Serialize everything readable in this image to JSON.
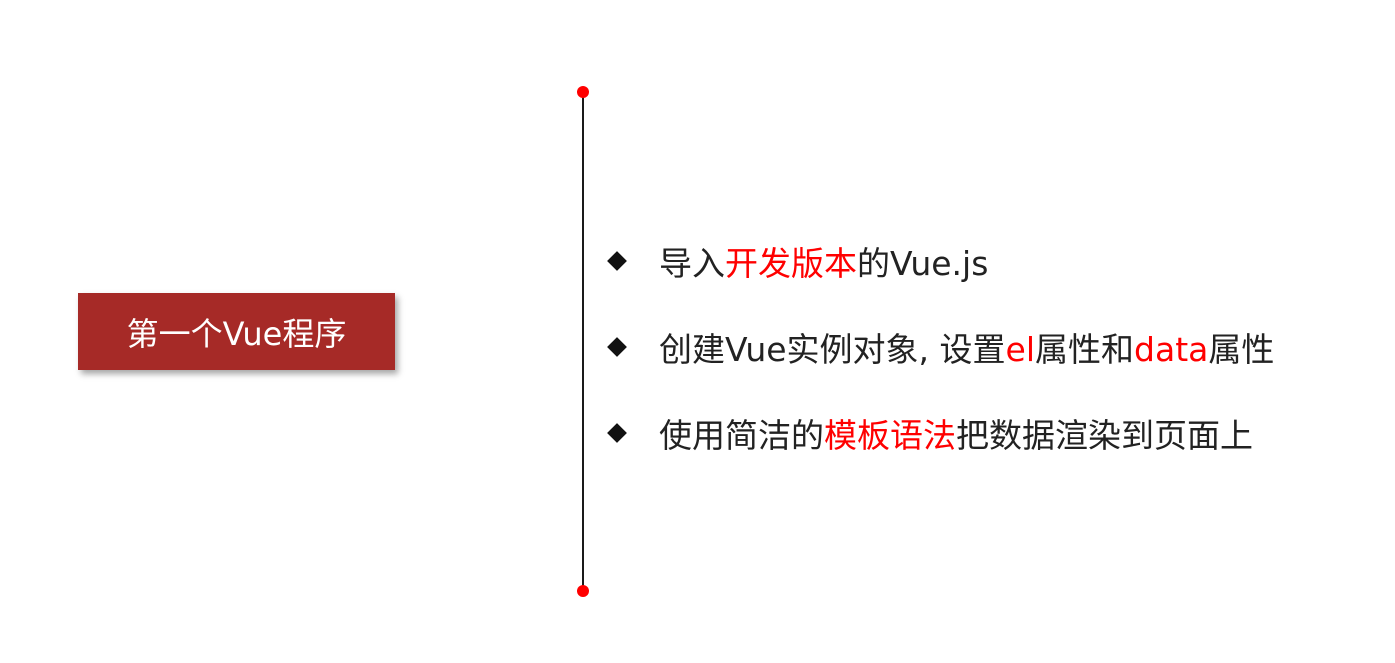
{
  "slide": {
    "title": "第一个Vue程序",
    "accent_color": "#a62a27",
    "highlight_color": "#ff0000",
    "bullets": [
      {
        "parts": [
          {
            "text": "导入",
            "highlight": false
          },
          {
            "text": "开发版本",
            "highlight": true
          },
          {
            "text": "的Vue.js",
            "highlight": false
          }
        ]
      },
      {
        "parts": [
          {
            "text": "创建Vue实例对象, 设置",
            "highlight": false
          },
          {
            "text": "el",
            "highlight": true
          },
          {
            "text": "属性和",
            "highlight": false
          },
          {
            "text": "data",
            "highlight": true
          },
          {
            "text": "属性",
            "highlight": false
          }
        ]
      },
      {
        "parts": [
          {
            "text": "使用简洁的",
            "highlight": false
          },
          {
            "text": "模板语法",
            "highlight": true
          },
          {
            "text": "把数据渲染到页面上",
            "highlight": false
          }
        ]
      }
    ]
  }
}
